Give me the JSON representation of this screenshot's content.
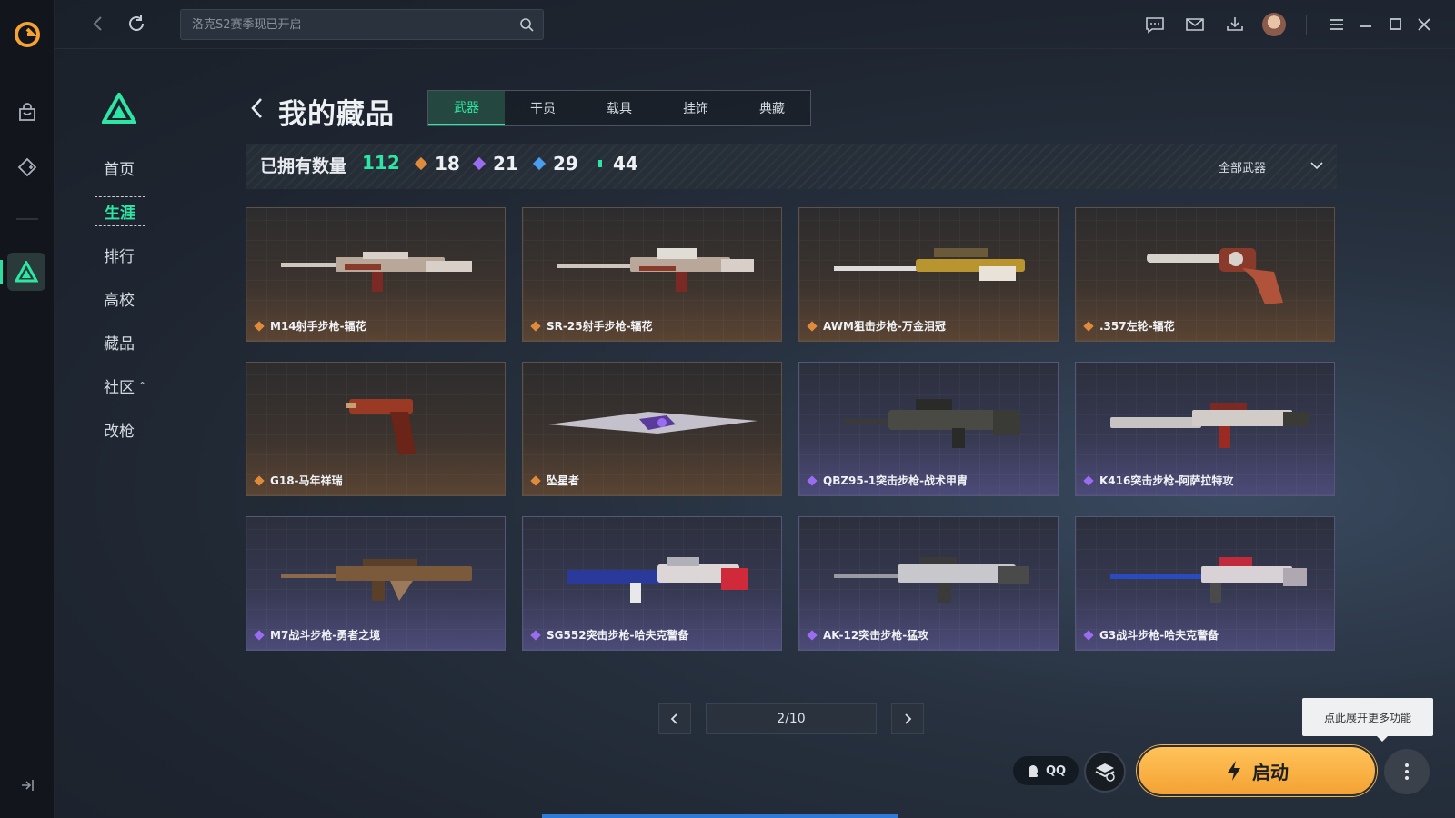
{
  "search": {
    "placeholder": "洛克S2赛季现已开启"
  },
  "sidebar": {
    "items": [
      {
        "label": "首页"
      },
      {
        "label": "生涯"
      },
      {
        "label": "排行"
      },
      {
        "label": "高校"
      },
      {
        "label": "藏品"
      },
      {
        "label": "社区"
      },
      {
        "label": "改枪"
      }
    ],
    "active_index": 1
  },
  "header": {
    "title": "我的藏品",
    "tabs": [
      {
        "label": "武器"
      },
      {
        "label": "干员"
      },
      {
        "label": "载具"
      },
      {
        "label": "挂饰"
      },
      {
        "label": "典藏"
      }
    ],
    "active_tab": 0
  },
  "summary": {
    "owned_label": "已拥有数量",
    "owned_count": "112",
    "tiers": [
      {
        "count": "18",
        "color": "#e08a3c"
      },
      {
        "count": "21",
        "color": "#9a6cf0"
      },
      {
        "count": "29",
        "color": "#4a9ef0"
      },
      {
        "count": "44",
        "color": "#2ee6a3"
      }
    ],
    "filter": "全部武器"
  },
  "items": [
    {
      "name": "M14射手步枪-辐花",
      "rarity": "gold"
    },
    {
      "name": "SR-25射手步枪-辐花",
      "rarity": "gold"
    },
    {
      "name": "AWM狙击步枪-万金泪冠",
      "rarity": "gold"
    },
    {
      "name": ".357左轮-辐花",
      "rarity": "gold"
    },
    {
      "name": "G18-马年祥瑞",
      "rarity": "gold"
    },
    {
      "name": "坠星者",
      "rarity": "gold"
    },
    {
      "name": "QBZ95-1突击步枪-战术甲胄",
      "rarity": "purple"
    },
    {
      "name": "K416突击步枪-阿萨拉特攻",
      "rarity": "purple"
    },
    {
      "name": "M7战斗步枪-勇者之境",
      "rarity": "purple"
    },
    {
      "name": "SG552突击步枪-哈夫克警备",
      "rarity": "purple"
    },
    {
      "name": "AK-12突击步枪-猛攻",
      "rarity": "purple"
    },
    {
      "name": "G3战斗步枪-哈夫克警备",
      "rarity": "purple"
    }
  ],
  "pagination": {
    "label": "2/10"
  },
  "footer": {
    "tooltip": "点此展开更多功能",
    "qq_label": "QQ",
    "launch_label": "启动"
  },
  "colors": {
    "accent": "#2ee6a3",
    "gold": "#e08a3c",
    "purple": "#9a6cf0",
    "launch": "#f4a233"
  }
}
